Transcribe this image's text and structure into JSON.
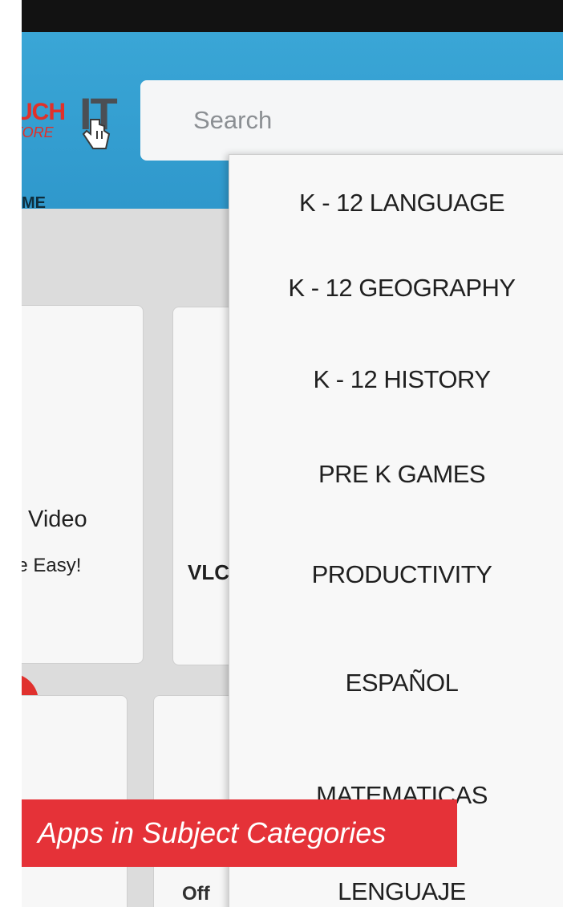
{
  "header": {
    "logo_touch": "UCH",
    "logo_it": "IT",
    "logo_store": "TORE",
    "search_placeholder": "Search",
    "nav_home": "ME"
  },
  "cards": {
    "video_title": "Video",
    "video_desc": "de Easy!",
    "vlc_title": "VLC",
    "office_text": "ffice",
    "bottom_text": "Off"
  },
  "dropdown": {
    "items": [
      "K - 12 LANGUAGE",
      "K - 12 GEOGRAPHY",
      "K - 12 HISTORY",
      "PRE K GAMES",
      "PRODUCTIVITY",
      "ESPAÑOL",
      "MATEMATICAS",
      "LENGUAJE"
    ]
  },
  "caption": "Apps in Subject Categories",
  "colors": {
    "header": "#2f98cc",
    "accent_red": "#e53238",
    "menu_bg": "#f8f8f8"
  }
}
